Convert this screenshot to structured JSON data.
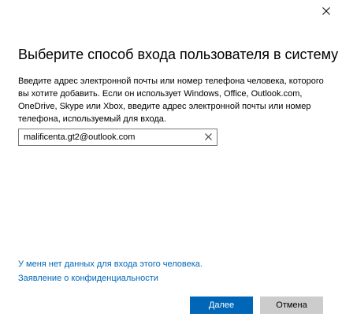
{
  "dialog": {
    "heading": "Выберите способ входа пользователя в систему",
    "description": "Введите адрес электронной почты или номер телефона человека, которого вы хотите добавить. Если он использует Windows, Office, Outlook.com, OneDrive, Skype или Xbox, введите адрес электронной почты или номер телефона, используемый для входа.",
    "email_value": "malificenta.gt2@outlook.com",
    "link_no_data": "У меня нет данных для входа этого человека.",
    "link_privacy": "Заявление о конфиденциальности",
    "next_label": "Далее",
    "cancel_label": "Отмена"
  },
  "icons": {
    "close": "close-icon",
    "clear": "clear-icon"
  },
  "colors": {
    "accent": "#0067b8",
    "secondary_button": "#cccccc",
    "input_border": "#7a7a7a"
  }
}
